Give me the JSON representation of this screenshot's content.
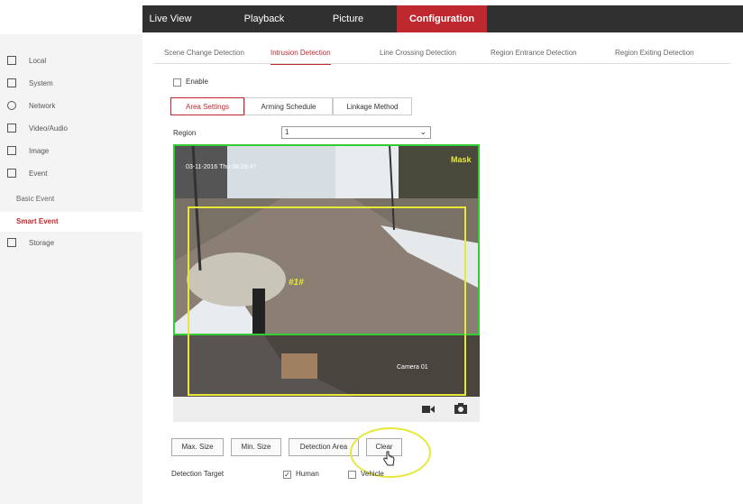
{
  "topnav": {
    "items": [
      {
        "label": "Live View",
        "active": false
      },
      {
        "label": "Playback",
        "active": false
      },
      {
        "label": "Picture",
        "active": false
      },
      {
        "label": "Configuration",
        "active": true
      }
    ]
  },
  "sidebar": {
    "items": [
      {
        "label": "Local",
        "icon": "monitor-icon"
      },
      {
        "label": "System",
        "icon": "system-icon"
      },
      {
        "label": "Network",
        "icon": "network-icon"
      },
      {
        "label": "Video/Audio",
        "icon": "video-audio-icon"
      },
      {
        "label": "Image",
        "icon": "image-icon"
      },
      {
        "label": "Event",
        "icon": "event-icon"
      }
    ],
    "subitems": [
      {
        "label": "Basic Event",
        "active": false
      },
      {
        "label": "Smart Event",
        "active": true
      }
    ],
    "storage": {
      "label": "Storage",
      "icon": "storage-icon"
    }
  },
  "tabs": [
    {
      "label": "Scene Change Detection",
      "active": false
    },
    {
      "label": "Intrusion Detection",
      "active": true
    },
    {
      "label": "Line Crossing Detection",
      "active": false
    },
    {
      "label": "Region Entrance Detection",
      "active": false
    },
    {
      "label": "Region Exiting Detection",
      "active": false
    }
  ],
  "enable": {
    "label": "Enable",
    "checked": false
  },
  "subtabs": [
    {
      "label": "Area Settings",
      "active": true
    },
    {
      "label": "Arming Schedule",
      "active": false
    },
    {
      "label": "Linkage Method",
      "active": false
    }
  ],
  "region": {
    "label": "Region",
    "value": "1"
  },
  "video": {
    "timestamp": "03-11-2016 Thu 08:29:47",
    "mask_label": "Mask",
    "region_label": "#1#",
    "camera_name": "Camera 01"
  },
  "buttons": {
    "max_size": "Max. Size",
    "min_size": "Min. Size",
    "detection_area": "Detection Area",
    "clear": "Clear"
  },
  "detection_target": {
    "label": "Detection Target",
    "human": {
      "label": "Human",
      "checked": true
    },
    "vehicle": {
      "label": "Vehicle",
      "checked": false
    }
  },
  "colors": {
    "accent": "#c0282f",
    "detection_box": "#e8e83a",
    "mask_green": "#33cc33"
  }
}
